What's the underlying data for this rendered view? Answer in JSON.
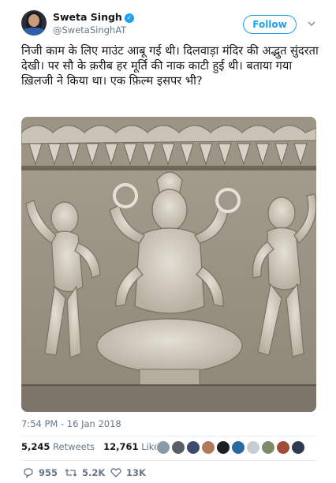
{
  "author": {
    "name": "Sweta Singh",
    "handle": "@SwetaSinghAT",
    "verified_icon": "verified-badge-icon"
  },
  "follow_label": "Follow",
  "tweet_text": "निजी काम के लिए माउंट आबू गई थी। दिलवाड़ा मंदिर की अद्भुत सुंदरता देखी। पर सौ के क़रीब हर मूर्ति की नाक काटी हुई थी। बताया गया ख़िलजी ने किया था। एक फ़िल्म इसपर भी?",
  "timestamp": "7:54 PM - 16 Jan 2018",
  "stats": {
    "retweets_count": "5,245",
    "retweets_label": "Retweets",
    "likes_count": "12,761",
    "likes_label": "Likes"
  },
  "actions": {
    "reply_count": "955",
    "retweet_count": "5.2K",
    "like_count": "13K"
  },
  "colors": {
    "accent": "#1da1f2",
    "text": "#14171a",
    "muted": "#657786"
  }
}
